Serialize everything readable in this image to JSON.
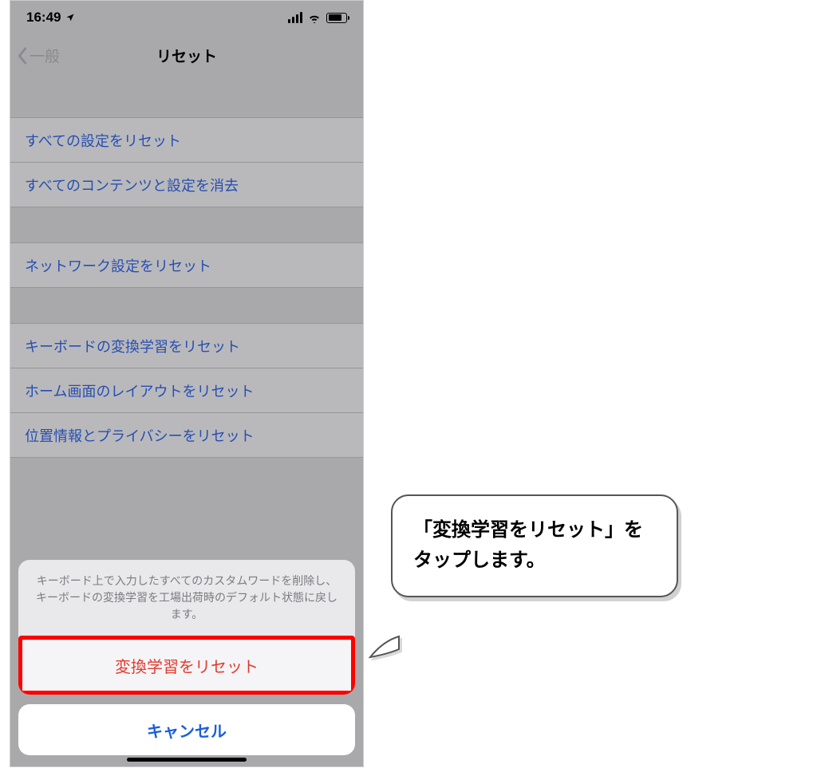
{
  "statusbar": {
    "time": "16:49"
  },
  "nav": {
    "back_label": "一般",
    "title": "リセット"
  },
  "rows": {
    "reset_all_settings": "すべての設定をリセット",
    "erase_all": "すべてのコンテンツと設定を消去",
    "reset_network": "ネットワーク設定をリセット",
    "reset_keyboard": "キーボードの変換学習をリセット",
    "reset_home": "ホーム画面のレイアウトをリセット",
    "reset_location": "位置情報とプライバシーをリセット"
  },
  "sheet": {
    "message": "キーボード上で入力したすべてのカスタムワードを削除し、キーボードの変換学習を工場出荷時のデフォルト状態に戻します。",
    "action_label": "変換学習をリセット",
    "cancel_label": "キャンセル"
  },
  "callout": {
    "text": "「変換学習をリセット」をタップします。"
  }
}
